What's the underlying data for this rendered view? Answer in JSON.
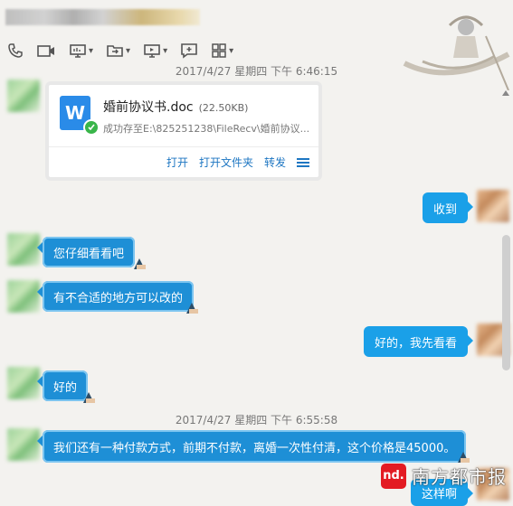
{
  "header": {
    "toolbar": [
      {
        "name": "phone-icon"
      },
      {
        "name": "video-icon"
      },
      {
        "name": "screen-share-icon",
        "dropdown": true
      },
      {
        "name": "file-transfer-icon",
        "dropdown": true
      },
      {
        "name": "remote-desktop-icon",
        "dropdown": true
      },
      {
        "name": "add-chat-icon"
      },
      {
        "name": "apps-grid-icon",
        "dropdown": true
      }
    ]
  },
  "timestamps": {
    "first": "2017/4/27 星期四 下午 6:46:15",
    "second": "2017/4/27 星期四 下午 6:55:58"
  },
  "file_card": {
    "icon_letter": "W",
    "file_name": "婚前协议书.doc",
    "file_size": "(22.50KB)",
    "path": "成功存至E:\\825251238\\FileRecv\\婚前协议...",
    "actions": {
      "open": "打开",
      "open_folder": "打开文件夹",
      "forward": "转发"
    }
  },
  "messages": [
    {
      "side": "right",
      "text": "收到"
    },
    {
      "side": "left",
      "text": "您仔细看看吧"
    },
    {
      "side": "left",
      "text": "有不合适的地方可以改的"
    },
    {
      "side": "right",
      "text": "好的，我先看看"
    },
    {
      "side": "left",
      "text": "好的"
    },
    {
      "side": "left",
      "text": "我们还有一种付款方式，前期不付款，离婚一次性付清，这个价格是45000。"
    },
    {
      "side": "right",
      "text": "这样啊"
    }
  ],
  "watermark": {
    "badge": "nd.",
    "name": "南方都市报"
  },
  "colors": {
    "bubble_left": "#1e8fd6",
    "bubble_right": "#1aa0e8",
    "link": "#1d76c2",
    "background": "#f3f2ef"
  }
}
